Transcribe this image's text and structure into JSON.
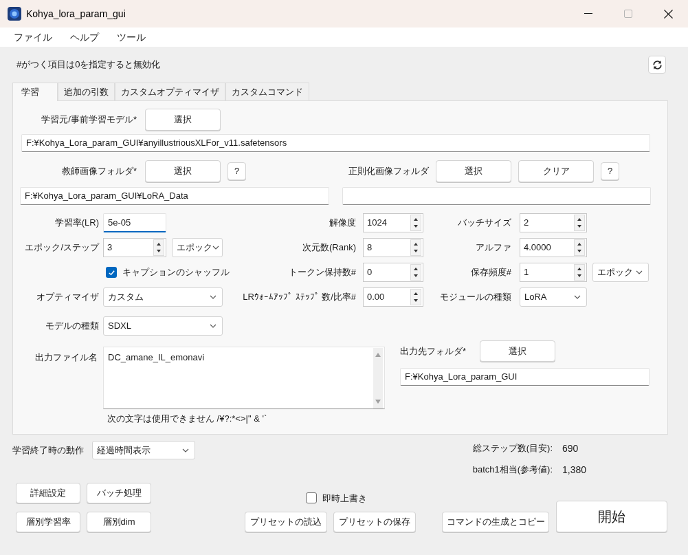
{
  "window": {
    "title": "Kohya_lora_param_gui"
  },
  "menu": [
    "ファイル",
    "ヘルプ",
    "ツール"
  ],
  "note": "#がつく項目は0を指定すると無効化",
  "tabs": [
    {
      "label": "学習",
      "selected": true
    },
    {
      "label": "追加の引数",
      "selected": false
    },
    {
      "label": "カスタムオプティマイザ",
      "selected": false
    },
    {
      "label": "カスタムコマンド",
      "selected": false
    }
  ],
  "model": {
    "label": "学習元/事前学習モデル*",
    "button": "選択",
    "path": "F:¥Kohya_Lora_param_GUI¥anyillustriousXLFor_v11.safetensors"
  },
  "teacher": {
    "label": "教師画像フォルダ*",
    "button": "選択",
    "help": "?",
    "path": "F:¥Kohya_Lora_param_GUI¥LoRA_Data"
  },
  "regularization": {
    "label": "正則化画像フォルダ",
    "button": "選択",
    "clear_button": "クリア",
    "help": "?"
  },
  "params": [
    {
      "left": {
        "label": "学習率(LR)",
        "kind": "text",
        "value": "5e-05",
        "focused": true
      },
      "middle": {
        "label": "解像度",
        "kind": "spin",
        "value": "1024"
      },
      "right": {
        "label": "バッチサイズ",
        "kind": "spin",
        "value": "2"
      }
    },
    {
      "left": {
        "label": "エポック/ステップ",
        "kind": "spin",
        "value": "3",
        "unit": "エポック"
      },
      "middle": {
        "label": "次元数(Rank)",
        "kind": "spin",
        "value": "8"
      },
      "right": {
        "label": "アルファ",
        "kind": "spin",
        "value": "4.0000"
      }
    },
    {
      "left": {
        "label": "キャプションのシャッフル",
        "kind": "checkbox",
        "checked": true
      },
      "middle": {
        "label": "トークン保持数#",
        "kind": "spin",
        "value": "0"
      },
      "right": {
        "label": "保存頻度#",
        "kind": "spin",
        "value": "1",
        "unit": "エポック"
      }
    },
    {
      "left": {
        "label": "オプティマイザ",
        "kind": "dropdown",
        "value": "カスタム"
      },
      "middle": {
        "label": "LRｳｫｰﾑｱｯﾌﾟ ｽﾃｯﾌﾟ 数/比率#",
        "kind": "spin",
        "value": "0.00"
      },
      "right": {
        "label": "モジュールの種類",
        "kind": "dropdown",
        "value": "LoRA"
      }
    },
    {
      "left": {
        "label": "モデルの種類",
        "kind": "dropdown",
        "value": "SDXL"
      }
    }
  ],
  "output_name": {
    "label": "出力ファイル名",
    "value": "DC_amane_IL_emonavi",
    "hint": "次の文字は使用できません /¥?:*<>|\" & '`"
  },
  "output_folder": {
    "label": "出力先フォルダ*",
    "button": "選択",
    "path": "F:¥Kohya_Lora_param_GUI"
  },
  "on_finish": {
    "label": "学習終了時の動作",
    "value": "経過時間表示"
  },
  "stats": [
    {
      "label": "総ステップ数(目安):",
      "value": "690"
    },
    {
      "label": "batch1相当(参考値):",
      "value": "1,380"
    }
  ],
  "tool_buttons": [
    "詳細設定",
    "バッチ処理",
    "層別学習率",
    "層別dim"
  ],
  "overwrite": {
    "label": "即時上書き",
    "checked": false
  },
  "preset_buttons": [
    "プリセットの読込",
    "プリセットの保存"
  ],
  "command_button": "コマンドの生成とコピー",
  "start_button": "開始"
}
